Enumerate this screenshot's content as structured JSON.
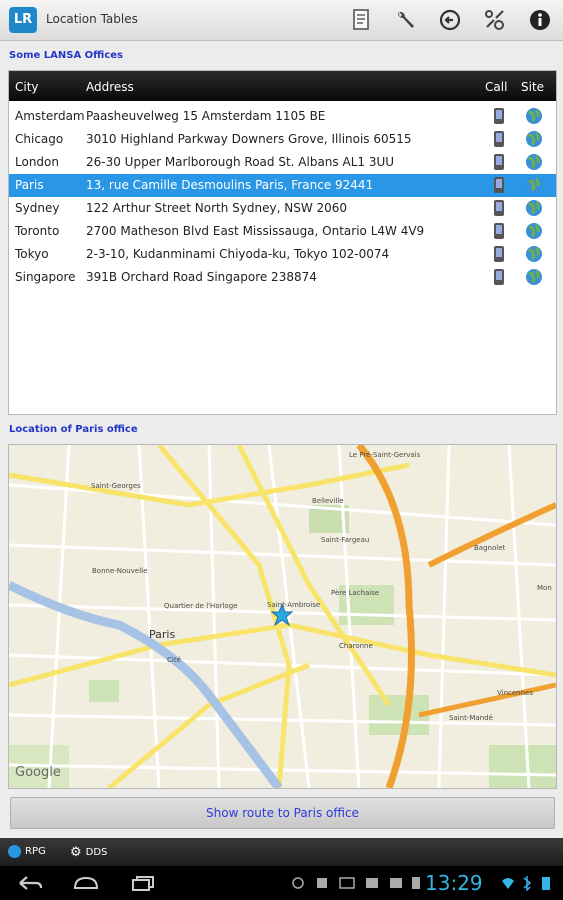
{
  "app": {
    "title": "Location Tables",
    "logo_text": "LR"
  },
  "offices_section": {
    "label": "Some LANSA Offices"
  },
  "table": {
    "headers": {
      "city": "City",
      "address": "Address",
      "call": "Call",
      "site": "Site"
    },
    "rows": [
      {
        "city": "Amsterdam",
        "address": "Paasheuvelweg 15 Amsterdam 1105 BE",
        "call_icon": "phone-icon",
        "site_icon": "globe-icon"
      },
      {
        "city": "Chicago",
        "address": "3010 Highland Parkway Downers Grove, Illinois 60515",
        "call_icon": "phone-icon",
        "site_icon": "globe-icon"
      },
      {
        "city": "London",
        "address": "26-30 Upper Marlborough Road St. Albans AL1 3UU",
        "call_icon": "phone-icon",
        "site_icon": "globe-icon"
      },
      {
        "city": "Paris",
        "address": "13, rue Camille Desmoulins Paris, France 92441",
        "call_icon": "phone-icon",
        "site_icon": "globe-icon",
        "selected": true
      },
      {
        "city": "Sydney",
        "address": "122 Arthur Street North Sydney, NSW 2060",
        "call_icon": "phone-icon",
        "site_icon": "globe-icon"
      },
      {
        "city": "Toronto",
        "address": "2700 Matheson Blvd East Mississauga, Ontario L4W 4V9",
        "call_icon": "phone-icon",
        "site_icon": "globe-icon"
      },
      {
        "city": "Tokyo",
        "address": "2-3-10, Kudanminami Chiyoda-ku, Tokyo 102-0074",
        "call_icon": "phone-icon",
        "site_icon": "globe-icon"
      },
      {
        "city": "Singapore",
        "address": "391B Orchard Road Singapore 238874",
        "call_icon": "phone-icon",
        "site_icon": "globe-icon"
      }
    ]
  },
  "map_section": {
    "label": "Location of Paris office"
  },
  "map": {
    "labels": {
      "paris": "Paris",
      "saint_ambroise": "Saint-Ambroise",
      "belleville": "Belleville",
      "bagnolet": "Bagnolet",
      "vincennes": "Vincennes",
      "montreuil": "Mon",
      "charonne": "Charonne",
      "pere_lachaise": "Père Lachaise",
      "saint_mande": "Saint-Mandé",
      "saint_georges": "Saint-Georges",
      "quartier_horloge": "Quartier de l'Horloge",
      "bonne_nouvelle": "Bonne-Nouvelle",
      "saint_fargeau": "Saint-Fargeau",
      "pre_saint_gervais": "Le Pré-Saint-Gervais",
      "cite": "Cité",
      "google": "Google"
    }
  },
  "route_button": {
    "label": "Show route to Paris office"
  },
  "bottom_tabs": [
    {
      "label": "RPG",
      "icon": "info-icon"
    },
    {
      "label": "DDS",
      "icon": "gear-icon"
    }
  ],
  "status": {
    "time": "13:29"
  },
  "colors": {
    "accent": "#33b5e5",
    "selected_row": "#2a97e6",
    "section_label": "#2336c9"
  }
}
